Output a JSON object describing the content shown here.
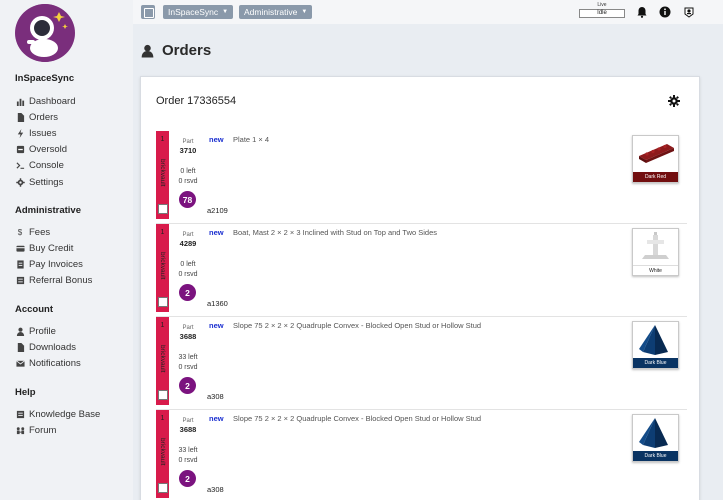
{
  "app": {
    "name": "InSpaceSync"
  },
  "sidebar": {
    "main": [
      {
        "label": "Dashboard",
        "icon": "bar-chart-icon"
      },
      {
        "label": "Orders",
        "icon": "file-icon"
      },
      {
        "label": "Issues",
        "icon": "bolt-icon"
      },
      {
        "label": "Oversold",
        "icon": "minus-square-icon"
      },
      {
        "label": "Console",
        "icon": "terminal-icon"
      },
      {
        "label": "Settings",
        "icon": "gear-icon"
      }
    ],
    "administrative": {
      "title": "Administrative",
      "items": [
        {
          "label": "Fees",
          "icon": "dollar-icon"
        },
        {
          "label": "Buy Credit",
          "icon": "credit-card-icon"
        },
        {
          "label": "Pay Invoices",
          "icon": "invoice-icon"
        },
        {
          "label": "Referral Bonus",
          "icon": "list-icon"
        }
      ]
    },
    "account": {
      "title": "Account",
      "items": [
        {
          "label": "Profile",
          "icon": "user-icon"
        },
        {
          "label": "Downloads",
          "icon": "file-icon"
        },
        {
          "label": "Notifications",
          "icon": "envelope-icon"
        }
      ]
    },
    "help": {
      "title": "Help",
      "items": [
        {
          "label": "Knowledge Base",
          "icon": "book-icon"
        },
        {
          "label": "Forum",
          "icon": "people-icon"
        }
      ]
    }
  },
  "topbar": {
    "store_dropdown": "InSpaceSync",
    "role_dropdown": "Administrative",
    "live_label": "Live",
    "live_status": "Idle"
  },
  "page": {
    "title": "Orders"
  },
  "order": {
    "title": "Order 17336554",
    "items": [
      {
        "qty": "1",
        "seller": "brickvault",
        "part_label": "Part",
        "part": "3710",
        "left": "0 left",
        "rsvd": "0 rsvd",
        "count": "78",
        "condition": "new",
        "description": "Plate 1 × 4",
        "location": "a2109",
        "color_name": "Dark Red",
        "color": "#720e0f"
      },
      {
        "qty": "1",
        "seller": "brickvault",
        "part_label": "Part",
        "part": "4289",
        "left": "0 left",
        "rsvd": "0 rsvd",
        "count": "2",
        "condition": "new",
        "description": "Boat, Mast 2 × 2 × 3 Inclined with Stud on Top and Two Sides",
        "location": "a1360",
        "color_name": "White",
        "color": "#ffffff"
      },
      {
        "qty": "1",
        "seller": "brickvault",
        "part_label": "Part",
        "part": "3688",
        "left": "33 left",
        "rsvd": "0 rsvd",
        "count": "2",
        "condition": "new",
        "description": "Slope 75 2 × 2 × 2 Quadruple Convex - Blocked Open Stud or Hollow Stud",
        "location": "a308",
        "color_name": "Dark Blue",
        "color": "#0a3463"
      },
      {
        "qty": "1",
        "seller": "brickvault",
        "part_label": "Part",
        "part": "3688",
        "left": "33 left",
        "rsvd": "0 rsvd",
        "count": "2",
        "condition": "new",
        "description": "Slope 75 2 × 2 × 2 Quadruple Convex - Blocked Open Stud or Hollow Stud",
        "location": "a308",
        "color_name": "Dark Blue",
        "color": "#0a3463"
      }
    ]
  }
}
